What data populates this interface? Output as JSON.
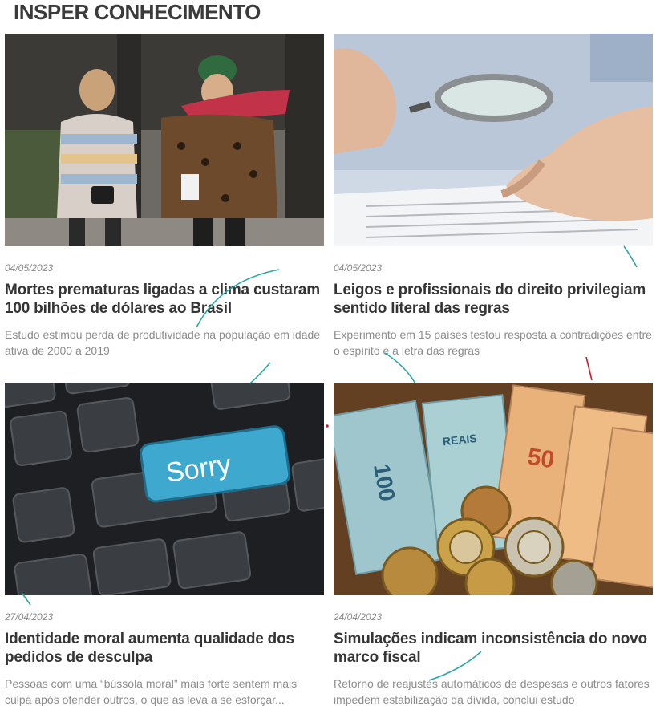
{
  "section": {
    "title": "INSPER CONHECIMENTO"
  },
  "articles": [
    {
      "date": "04/05/2023",
      "title": "Mortes prematuras ligadas a clima custaram 100 bilhões de dólares ao Brasil",
      "description": "Estudo estimou perda de produtividade na população em idade ativa de 2000 a 2019",
      "image_icon": "people-walking-cold-photo"
    },
    {
      "date": "04/05/2023",
      "title": "Leigos e profissionais do direito privilegiam sentido literal das regras",
      "description": "Experimento em 15 países testou resposta a contradições entre o espírito e a letra das regras",
      "image_icon": "magnifying-glass-document-photo"
    },
    {
      "date": "27/04/2023",
      "title": "Identidade moral aumenta qualidade dos pedidos de desculpa",
      "description": "Pessoas com uma “bússola moral” mais forte sentem mais culpa após ofender outros, o que as leva a se esforçar...",
      "image_icon": "sorry-keyboard-photo",
      "key_label": "Sorry"
    },
    {
      "date": "24/04/2023",
      "title": "Simulações indicam inconsistência do novo marco fiscal",
      "description": "Retorno de reajustes automáticos de despesas e outros fatores impedem estabilização da dívida, conclui estudo",
      "image_icon": "brazilian-money-photo",
      "note_labels": [
        "100",
        "REAIS",
        "50"
      ]
    }
  ],
  "colors": {
    "accent_line": "#2aa7a6",
    "red_line": "#d11a2a",
    "title": "#353535",
    "muted": "#8c8c8c"
  }
}
